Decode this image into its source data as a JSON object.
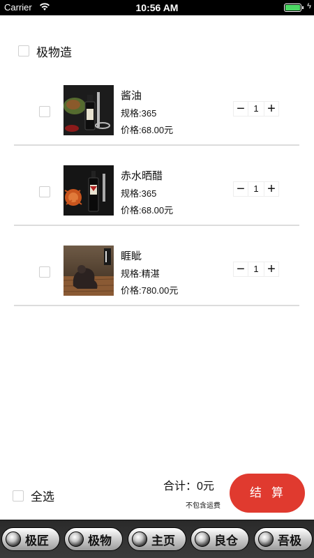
{
  "status_bar": {
    "carrier": "Carrier",
    "time": "10:56 AM",
    "battery_level": 1.0
  },
  "shop": {
    "name": "极物造"
  },
  "cart_items": [
    {
      "name": "酱油",
      "spec": "规格:365",
      "price": "价格:68.00元",
      "quantity": "1",
      "minus": "−",
      "plus": "+"
    },
    {
      "name": "赤水晒醋",
      "spec": "规格:365",
      "price": "价格:68.00元",
      "quantity": "1",
      "minus": "−",
      "plus": "+"
    },
    {
      "name": "睚眦",
      "spec": "规格:精湛",
      "price": "价格:780.00元",
      "quantity": "1",
      "minus": "−",
      "plus": "+"
    }
  ],
  "summary": {
    "select_all": "全选",
    "total": "合计：0元",
    "shipping_note": "不包含运费",
    "checkout": "结算"
  },
  "tabs": [
    {
      "label": "极匠"
    },
    {
      "label": "极物"
    },
    {
      "label": "主页"
    },
    {
      "label": "良仓"
    },
    {
      "label": "吾极"
    }
  ],
  "colors": {
    "accent": "#e03a2f",
    "tab_bar": "#333333",
    "battery": "#4cd964"
  }
}
